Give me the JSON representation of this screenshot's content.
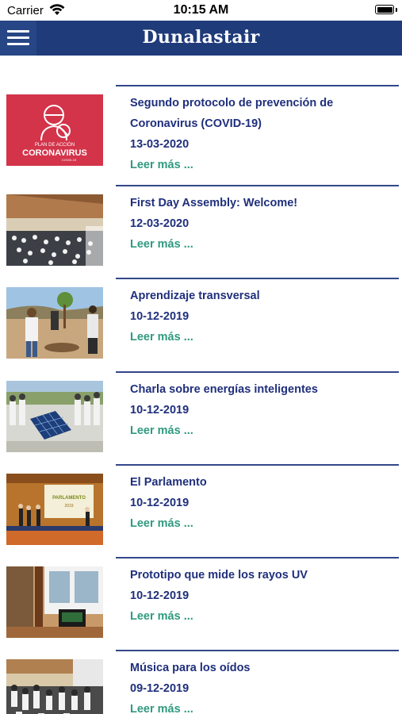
{
  "status_bar": {
    "carrier": "Carrier",
    "time": "10:15 AM"
  },
  "navbar": {
    "title": "Dunalastair",
    "menu_icon": "hamburger-menu-icon"
  },
  "colors": {
    "navbar": "#1f3b7a",
    "title_text": "#1f2f7c",
    "link": "#2f9a7f"
  },
  "thumb_text": {
    "plan": "PLAN DE ACCIÓN",
    "coronavirus": "CORONAVIRUS",
    "covid": "COVID-19",
    "parlamento": "PARLAMENTO",
    "year": "2019"
  },
  "news": [
    {
      "title": "Segundo protocolo de prevención de Coronavirus (COVID-19)",
      "date": "13-03-2020",
      "more": "Leer más ..."
    },
    {
      "title": "First Day Assembly: Welcome!",
      "date": "12-03-2020",
      "more": "Leer más ..."
    },
    {
      "title": "Aprendizaje transversal",
      "date": "10-12-2019",
      "more": "Leer más ..."
    },
    {
      "title": "Charla sobre energías inteligentes",
      "date": "10-12-2019",
      "more": "Leer más ..."
    },
    {
      "title": "El Parlamento",
      "date": "10-12-2019",
      "more": "Leer más ..."
    },
    {
      "title": "Prototipo que mide los rayos UV",
      "date": "10-12-2019",
      "more": "Leer más ..."
    },
    {
      "title": "Música para los oídos",
      "date": "09-12-2019",
      "more": "Leer más ..."
    }
  ]
}
